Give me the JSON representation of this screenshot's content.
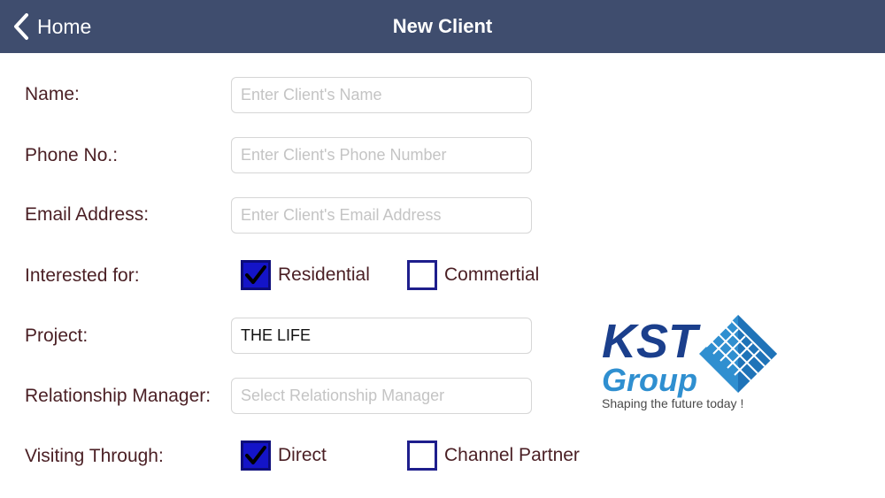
{
  "nav": {
    "back_label": "Home",
    "title": "New Client",
    "bg_color": "#3f4d6e"
  },
  "form": {
    "name": {
      "label": "Name:",
      "placeholder": "Enter Client's Name",
      "value": ""
    },
    "phone": {
      "label": "Phone No.:",
      "placeholder": "Enter Client's Phone Number",
      "value": ""
    },
    "email": {
      "label": "Email Address:",
      "placeholder": "Enter Client's Email Address",
      "value": ""
    },
    "interested": {
      "label": "Interested for:",
      "options": [
        {
          "label": "Residential",
          "checked": true
        },
        {
          "label": "Commertial",
          "checked": false
        }
      ]
    },
    "project": {
      "label": "Project:",
      "value": "THE LIFE"
    },
    "manager": {
      "label": "Relationship Manager:",
      "placeholder": "Select Relationship Manager",
      "value": ""
    },
    "visiting": {
      "label": "Visiting Through:",
      "options": [
        {
          "label": "Direct",
          "checked": true
        },
        {
          "label": "Channel Partner",
          "checked": false
        }
      ]
    }
  },
  "logo": {
    "brand": "KST",
    "group": "Group",
    "tagline": "Shaping the future today !",
    "brand_color": "#1b3f8c",
    "accent_color": "#2f8fd0"
  }
}
